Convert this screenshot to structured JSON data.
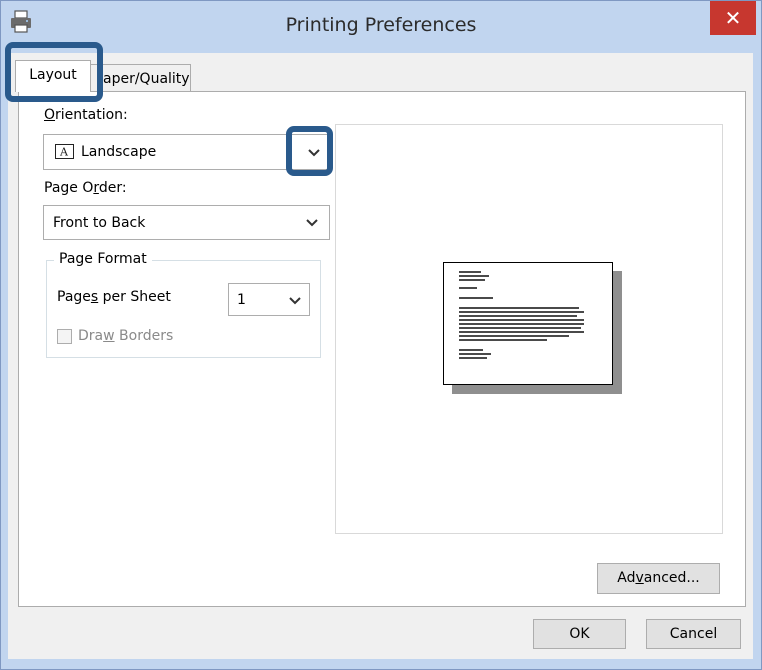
{
  "window": {
    "title": "Printing Preferences",
    "close_glyph": "✕"
  },
  "tabs": [
    {
      "label": "Layout",
      "active": true
    },
    {
      "label": "aper/Quality",
      "active": false
    }
  ],
  "layout": {
    "orientation": {
      "label_first": "O",
      "label_rest": "rientation:",
      "value": "Landscape",
      "icon": "landscape-page-icon"
    },
    "page_order": {
      "label_pre": "Page O",
      "label_u": "r",
      "label_post": "der:",
      "value": "Front to Back"
    },
    "page_format": {
      "title": "Page Format",
      "pages_per_sheet": {
        "label_pre": "Page",
        "label_u": "s",
        "label_post": " per Sheet",
        "value": "1"
      },
      "draw_borders": {
        "label_pre": "Dra",
        "label_u": "w",
        "label_post": " Borders",
        "checked": false,
        "enabled": false
      }
    }
  },
  "buttons": {
    "advanced_pre": "Ad",
    "advanced_u": "v",
    "advanced_post": "anced...",
    "ok": "OK",
    "cancel": "Cancel"
  },
  "colors": {
    "highlight": "#2a5a8c",
    "close": "#c7372f",
    "frame": "#c1d5ef"
  }
}
